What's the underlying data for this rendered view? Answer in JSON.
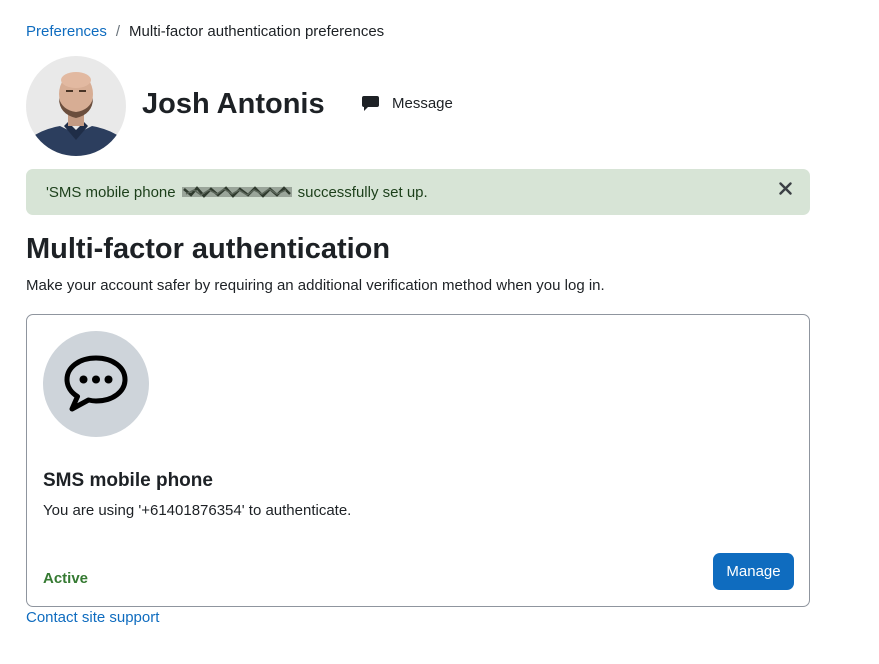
{
  "breadcrumb": {
    "parent": "Preferences",
    "separator": "/",
    "current": "Multi-factor authentication preferences"
  },
  "user": {
    "name": "Josh Antonis",
    "message_label": "Message"
  },
  "alert": {
    "text_before": "'SMS mobile phone",
    "text_after": "successfully set up.",
    "close_icon": "close-icon",
    "color": "#d7e4d6"
  },
  "page": {
    "title": "Multi-factor authentication",
    "intro": "Make your account safer by requiring an additional verification method when you log in."
  },
  "factor": {
    "icon": "chat-bubble-dots-icon",
    "name": "SMS mobile phone",
    "description": "You are using '+61401876354' to authenticate.",
    "status": "Active",
    "status_color": "#357a32",
    "manage_label": "Manage"
  },
  "footer": {
    "support_link": "Contact site support"
  },
  "colors": {
    "link": "#0f6cbf",
    "primary_button": "#0f6cbf"
  }
}
